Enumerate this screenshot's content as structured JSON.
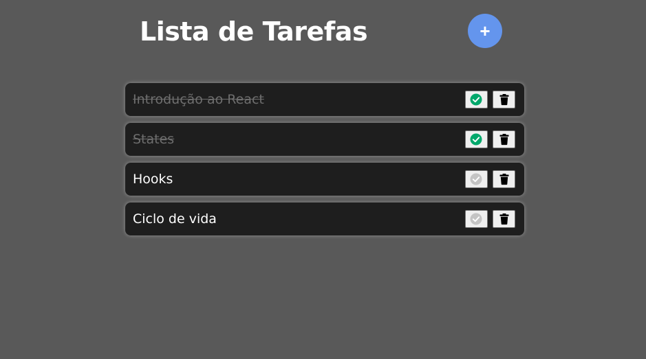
{
  "header": {
    "title": "Lista de Tarefas",
    "add_button": {
      "label": "+",
      "icon": "plus-icon",
      "color": "#6495ed"
    }
  },
  "colors": {
    "background": "#595959",
    "card": "#1e1e1e",
    "done_check": "#00a86b",
    "pending_check": "#c4c4c4",
    "done_text": "#6e6e6e"
  },
  "tasks": [
    {
      "text": "Introdução ao React",
      "completed": true
    },
    {
      "text": "States",
      "completed": true
    },
    {
      "text": "Hooks",
      "completed": false
    },
    {
      "text": "Ciclo de vida",
      "completed": false
    }
  ]
}
